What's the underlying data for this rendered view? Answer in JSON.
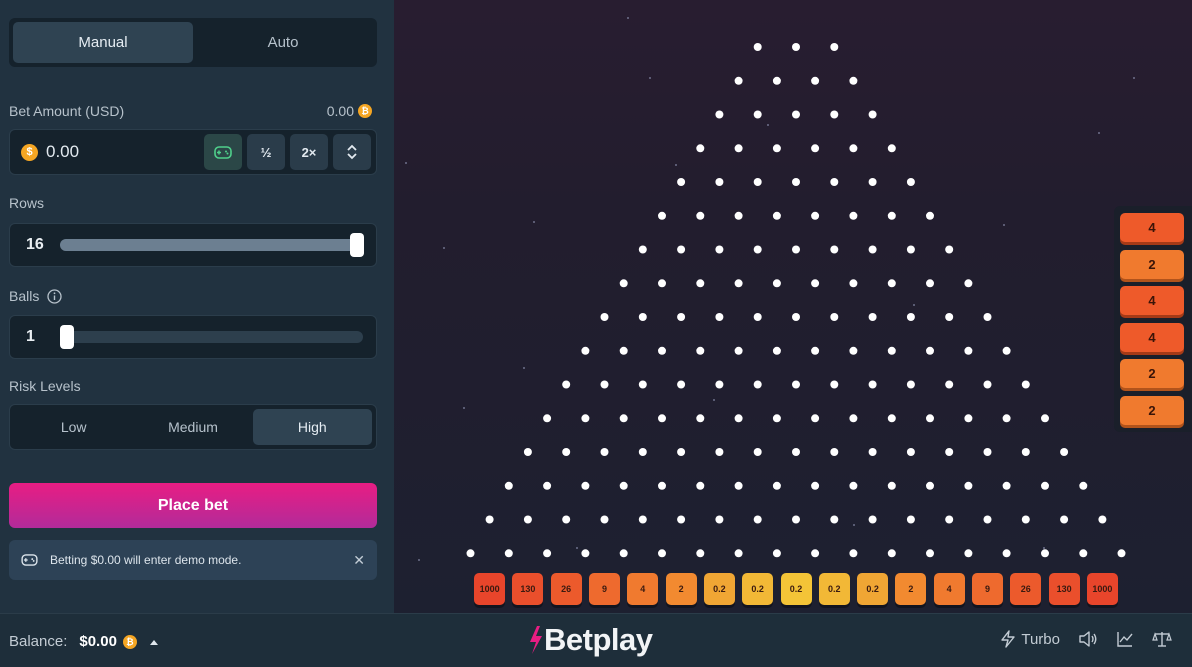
{
  "mode_tabs": {
    "manual": "Manual",
    "auto": "Auto"
  },
  "bet": {
    "label": "Bet Amount (USD)",
    "crypto_amount": "0.00",
    "value": "0.00",
    "half_label": "½",
    "double_label": "2×"
  },
  "rows": {
    "label": "Rows",
    "value": "16",
    "fraction": 1.0
  },
  "balls": {
    "label": "Balls",
    "value": "1",
    "fraction": 0.0
  },
  "risk": {
    "label": "Risk Levels",
    "options": [
      "Low",
      "Medium",
      "High"
    ],
    "selected": "High"
  },
  "place_bet": "Place bet",
  "demo_notice": "Betting $0.00 will enter demo mode.",
  "multipliers": [
    "1000",
    "130",
    "26",
    "9",
    "4",
    "2",
    "0.2",
    "0.2",
    "0.2",
    "0.2",
    "0.2",
    "2",
    "4",
    "9",
    "26",
    "130",
    "1000"
  ],
  "multiplier_colors": [
    "#e8452b",
    "#ea4f2c",
    "#ec5a2c",
    "#ee6a2e",
    "#f07a2f",
    "#f28a30",
    "#f0a634",
    "#f2b836",
    "#f4c437",
    "#f2b836",
    "#f0a634",
    "#f28a30",
    "#f07a2f",
    "#ee6a2e",
    "#ec5a2c",
    "#ea4f2c",
    "#e8452b"
  ],
  "history": [
    "4",
    "2",
    "4",
    "4",
    "2",
    "2"
  ],
  "footer": {
    "balance_label": "Balance:",
    "balance_value": "$0.00",
    "brand": "Betplay",
    "turbo": "Turbo"
  },
  "accent": "#e81d83"
}
